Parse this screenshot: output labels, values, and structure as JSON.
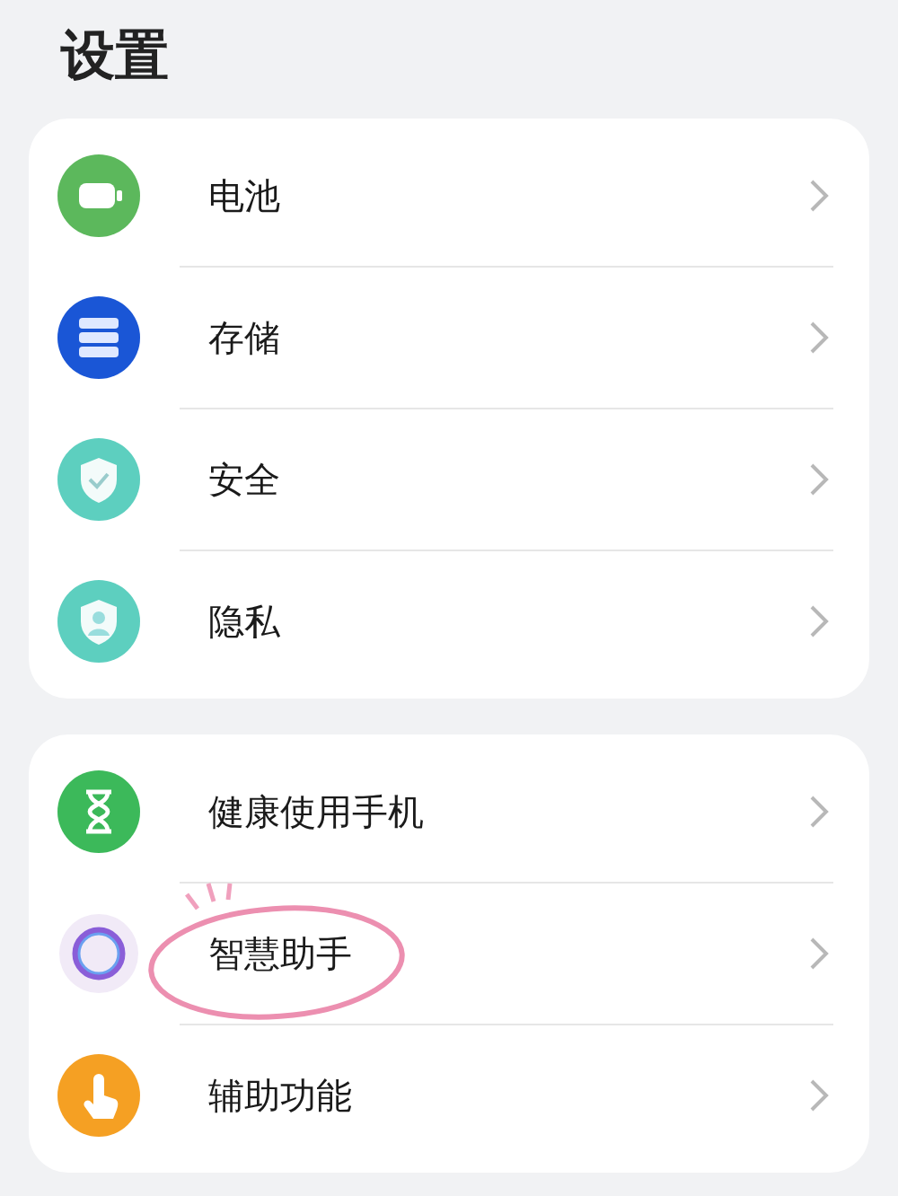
{
  "title": "设置",
  "groups": [
    {
      "items": [
        {
          "label": "电池",
          "kind": "battery",
          "circled": false
        },
        {
          "label": "存储",
          "kind": "storage",
          "circled": false
        },
        {
          "label": "安全",
          "kind": "security",
          "circled": false
        },
        {
          "label": "隐私",
          "kind": "privacy",
          "circled": false
        }
      ]
    },
    {
      "items": [
        {
          "label": "健康使用手机",
          "kind": "hourglass",
          "circled": false
        },
        {
          "label": "智慧助手",
          "kind": "assistant",
          "circled": true
        },
        {
          "label": "辅助功能",
          "kind": "accessibility",
          "circled": false
        }
      ]
    }
  ]
}
